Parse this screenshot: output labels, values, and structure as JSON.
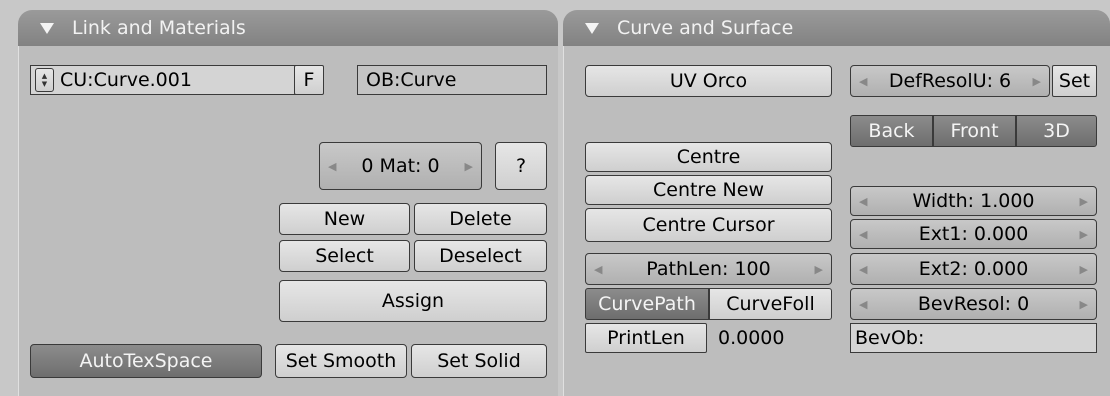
{
  "link_panel": {
    "title": "Link and Materials",
    "curve_name": "CU:Curve.001",
    "fake_user_label": "F",
    "object_name": "OB:Curve",
    "mat_label": "0 Mat: 0",
    "mat_help_label": "?",
    "new_label": "New",
    "delete_label": "Delete",
    "select_label": "Select",
    "deselect_label": "Deselect",
    "assign_label": "Assign",
    "autotexspace_label": "AutoTexSpace",
    "set_smooth_label": "Set Smooth",
    "set_solid_label": "Set Solid"
  },
  "curve_panel": {
    "title": "Curve and Surface",
    "uv_orco_label": "UV Orco",
    "defresolu_label": "DefResolU: 6",
    "set_label": "Set",
    "back_label": "Back",
    "front_label": "Front",
    "3d_label": "3D",
    "centre_label": "Centre",
    "centre_new_label": "Centre New",
    "centre_cursor_label": "Centre Cursor",
    "width_label": "Width: 1.000",
    "ext1_label": "Ext1: 0.000",
    "pathlen_label": "PathLen: 100",
    "ext2_label": "Ext2: 0.000",
    "curvepath_label": "CurvePath",
    "curvefoll_label": "CurveFoll",
    "bevresol_label": "BevResol: 0",
    "printlen_label": "PrintLen",
    "printlen_value": "0.0000",
    "bevob_label": "BevOb:"
  },
  "colors": {
    "background": "#c8c8c8",
    "panel": "#bdbdbd",
    "header": "#8c8c8c",
    "active_button": "#7a7a7a"
  }
}
